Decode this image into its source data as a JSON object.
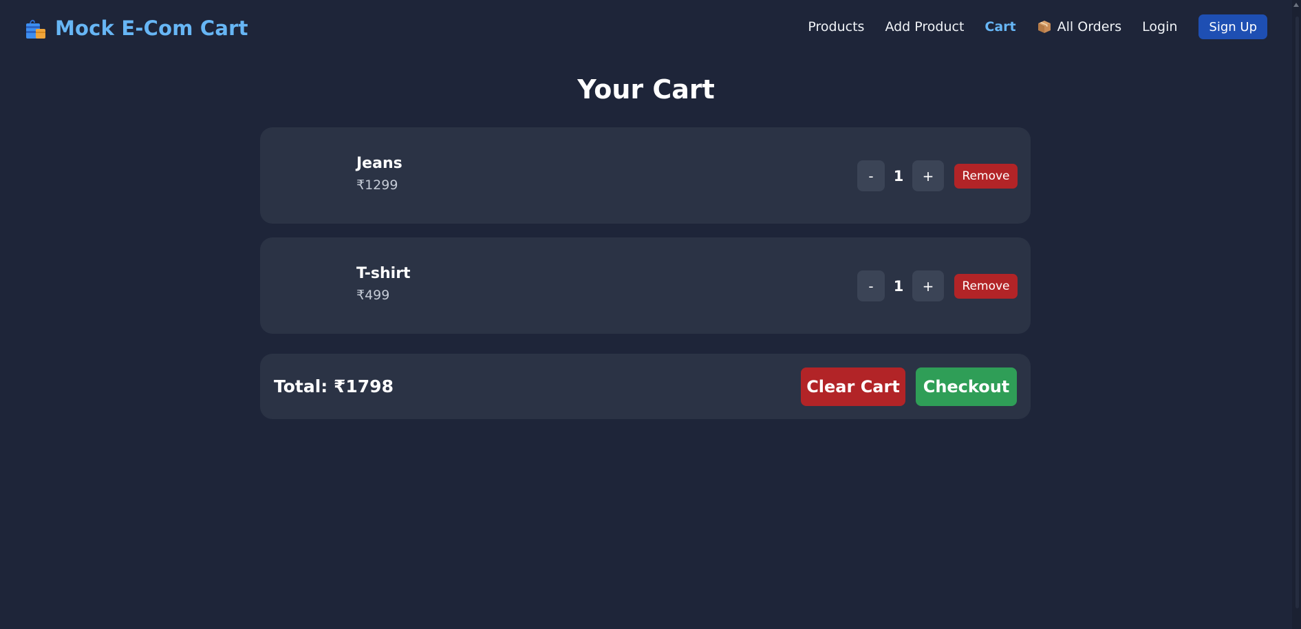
{
  "brand": {
    "title": "Mock E-Com Cart",
    "icon": "shopping-bag-icon"
  },
  "nav": {
    "products": "Products",
    "add_product": "Add Product",
    "cart": "Cart",
    "all_orders": "All Orders",
    "all_orders_icon": "package-icon",
    "login": "Login",
    "signup": "Sign Up"
  },
  "main": {
    "title": "Your Cart",
    "items": [
      {
        "name": "Jeans",
        "price": "₹1299",
        "quantity": "1",
        "decrement": "-",
        "increment": "+",
        "remove": "Remove"
      },
      {
        "name": "T-shirt",
        "price": "₹499",
        "quantity": "1",
        "decrement": "-",
        "increment": "+",
        "remove": "Remove"
      }
    ],
    "total": "Total: ₹1798",
    "clear_cart": "Clear Cart",
    "checkout": "Checkout"
  },
  "colors": {
    "background": "#1e2539",
    "card": "#2b3345",
    "accent": "#67b6f5",
    "danger": "#b22427",
    "success": "#2f9e57",
    "primary": "#1e4fb3"
  }
}
